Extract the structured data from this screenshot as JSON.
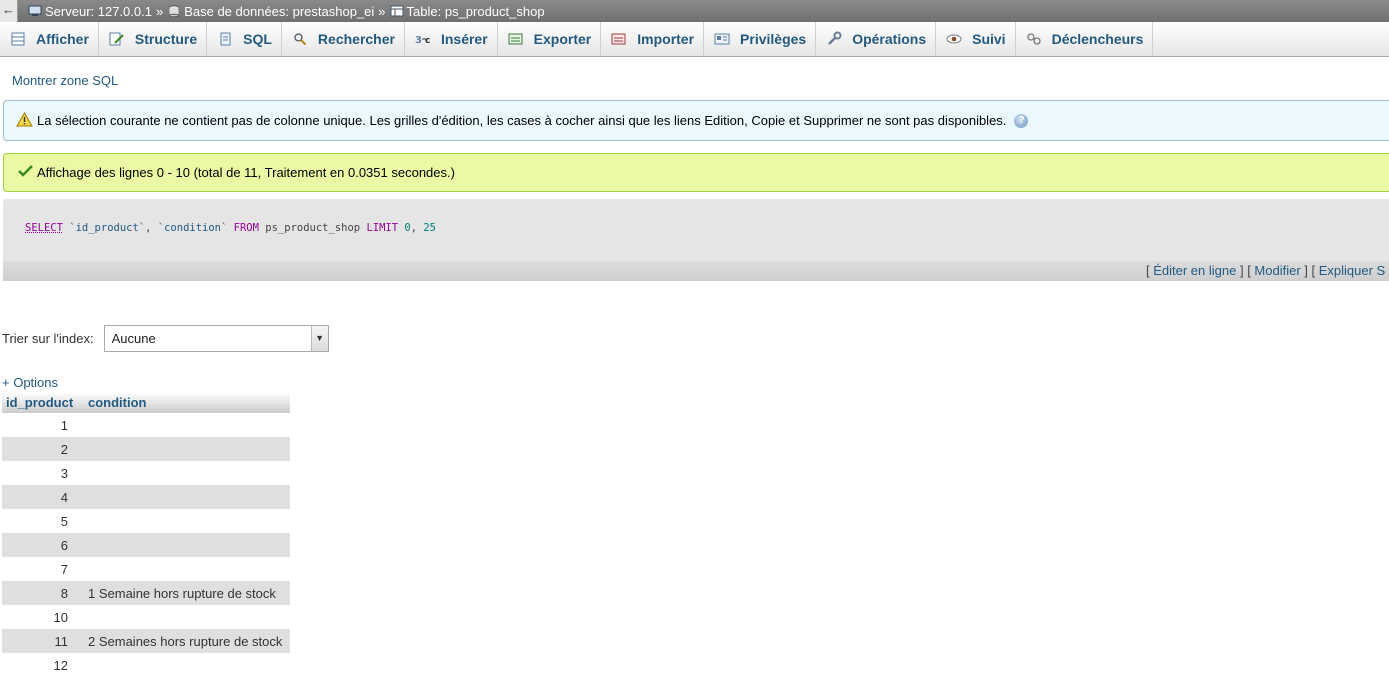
{
  "breadcrumb": {
    "back": "←",
    "server": "Serveur: 127.0.0.1",
    "database": "Base de données: prestashop_ei",
    "table": "Table: ps_product_shop",
    "separator": "»"
  },
  "tabs": [
    {
      "label": "Afficher",
      "icon": "browse-icon"
    },
    {
      "label": "Structure",
      "icon": "structure-icon"
    },
    {
      "label": "SQL",
      "icon": "sql-icon"
    },
    {
      "label": "Rechercher",
      "icon": "search-icon"
    },
    {
      "label": "Insérer",
      "icon": "insert-icon"
    },
    {
      "label": "Exporter",
      "icon": "export-icon"
    },
    {
      "label": "Importer",
      "icon": "import-icon"
    },
    {
      "label": "Privilèges",
      "icon": "privileges-icon"
    },
    {
      "label": "Opérations",
      "icon": "wrench-icon"
    },
    {
      "label": "Suivi",
      "icon": "eye-icon"
    },
    {
      "label": "Déclencheurs",
      "icon": "triggers-icon"
    }
  ],
  "show_sql_link": "Montrer zone SQL",
  "notice": {
    "text": "La sélection courante ne contient pas de colonne unique. Les grilles d'édition, les cases à cocher ainsi que les liens Edition, Copie et Supprimer ne sont pas disponibles.",
    "help": "?"
  },
  "success": {
    "text": "Affichage des lignes 0 - 10 (total de 11, Traitement en 0.0351 secondes.)"
  },
  "sql": {
    "select": "SELECT",
    "col1": "`id_product`",
    "comma": ",",
    "col2": "`condition`",
    "from": "FROM",
    "table": "ps_product_shop",
    "limit": "LIMIT",
    "n1": "0",
    "n2": "25"
  },
  "sql_links": {
    "edit_inline": "Éditer en ligne",
    "modify": "Modifier",
    "explain": "Expliquer S"
  },
  "sort": {
    "label": "Trier sur l'index:",
    "selected": "Aucune"
  },
  "options_link": "+ Options",
  "table": {
    "headers": [
      "id_product",
      "condition"
    ],
    "rows": [
      {
        "id": "1",
        "condition": ""
      },
      {
        "id": "2",
        "condition": ""
      },
      {
        "id": "3",
        "condition": ""
      },
      {
        "id": "4",
        "condition": ""
      },
      {
        "id": "5",
        "condition": ""
      },
      {
        "id": "6",
        "condition": ""
      },
      {
        "id": "7",
        "condition": ""
      },
      {
        "id": "8",
        "condition": "1 Semaine hors rupture de stock"
      },
      {
        "id": "10",
        "condition": ""
      },
      {
        "id": "11",
        "condition": "2 Semaines hors rupture de stock"
      },
      {
        "id": "12",
        "condition": ""
      }
    ]
  }
}
